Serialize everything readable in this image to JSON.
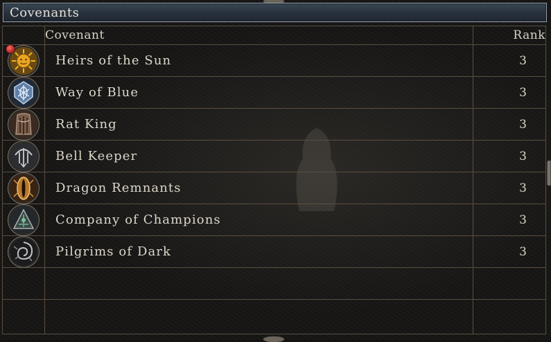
{
  "window": {
    "title": "Covenants"
  },
  "table": {
    "headers": {
      "covenant": "Covenant",
      "rank": "Rank"
    },
    "rows": [
      {
        "name": "Heirs of the Sun",
        "rank": "3",
        "icon": "sun-emblem-icon",
        "active": true
      },
      {
        "name": "Way of Blue",
        "rank": "3",
        "icon": "blue-shield-emblem-icon",
        "active": false
      },
      {
        "name": "Rat King",
        "rank": "3",
        "icon": "rat-king-emblem-icon",
        "active": false
      },
      {
        "name": "Bell Keeper",
        "rank": "3",
        "icon": "bell-keeper-emblem-icon",
        "active": false
      },
      {
        "name": "Dragon Remnants",
        "rank": "3",
        "icon": "dragon-eye-emblem-icon",
        "active": false
      },
      {
        "name": "Company of Champions",
        "rank": "3",
        "icon": "champions-emblem-icon",
        "active": false
      },
      {
        "name": "Pilgrims of Dark",
        "rank": "3",
        "icon": "dark-vortex-emblem-icon",
        "active": false
      }
    ]
  },
  "colors": {
    "title_bar": "#2b3542",
    "grid_line": "#5b4f42",
    "active_marker": "#c02020",
    "text": "#dcd7ca"
  }
}
